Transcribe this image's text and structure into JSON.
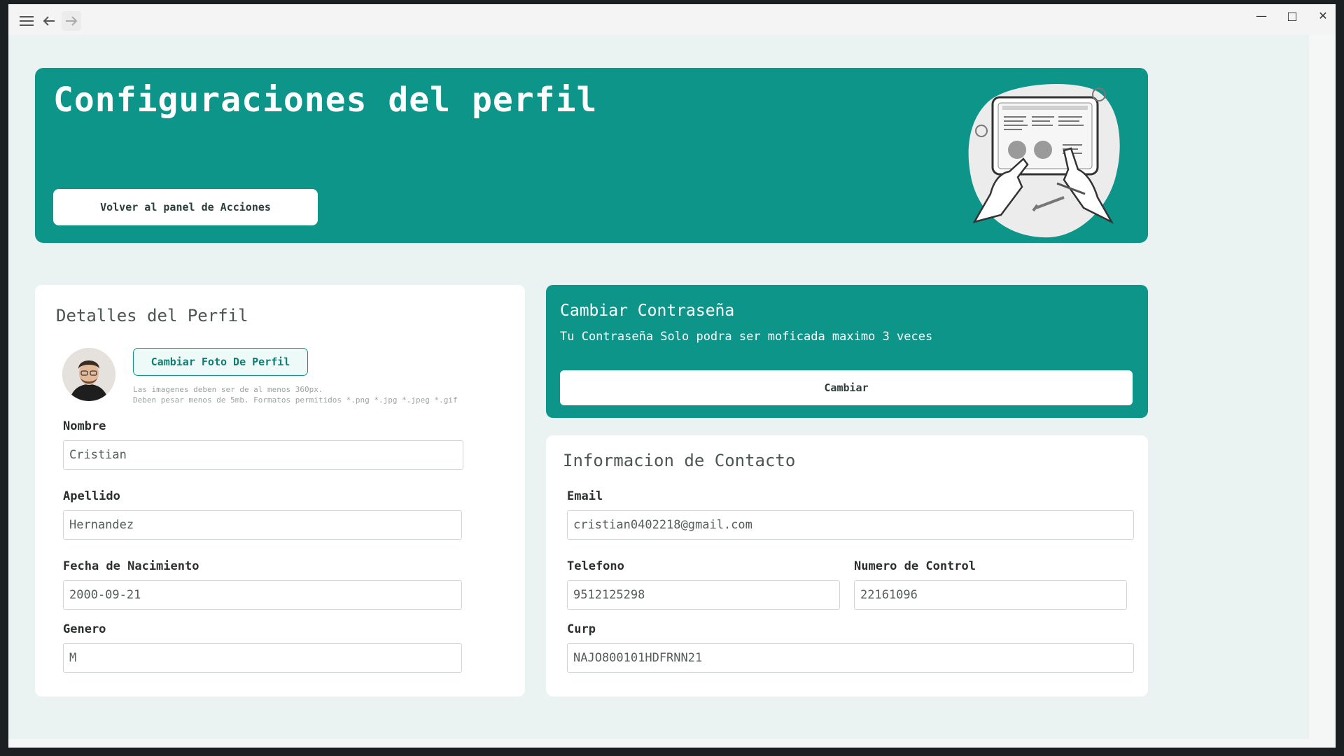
{
  "window": {
    "controls": {
      "minimize": "—",
      "maximize": "□",
      "close": "✕"
    },
    "nav": {
      "menu_icon": "menu-icon",
      "back_icon": "arrow-left-icon",
      "forward_icon": "arrow-right-icon"
    }
  },
  "colors": {
    "accent": "#0e958a",
    "background": "#eaf3f1"
  },
  "hero": {
    "title": "Configuraciones del perfil",
    "back_button": "Volver al panel de Acciones"
  },
  "profile": {
    "title": "Detalles del Perfil",
    "change_photo_button": "Cambiar Foto De Perfil",
    "photo_hint_line1": "Las imagenes deben ser de al menos 360px.",
    "photo_hint_line2": "Deben pesar menos de 5mb. Formatos permitidos *.png *.jpg *.jpeg *.gif",
    "fields": {
      "nombre": {
        "label": "Nombre",
        "value": "Cristian"
      },
      "apellido": {
        "label": "Apellido",
        "value": "Hernandez"
      },
      "fecha": {
        "label": "Fecha de Nacimiento",
        "value": "2000-09-21"
      },
      "genero": {
        "label": "Genero",
        "value": "M"
      }
    }
  },
  "password": {
    "title": "Cambiar Contraseña",
    "subtitle": "Tu Contraseña Solo podra ser moficada maximo 3 veces",
    "button": "Cambiar"
  },
  "contact": {
    "title": "Informacion de Contacto",
    "fields": {
      "email": {
        "label": "Email",
        "value": "cristian0402218@gmail.com"
      },
      "telefono": {
        "label": "Telefono",
        "value": "9512125298"
      },
      "control": {
        "label": "Numero de Control",
        "value": "22161096"
      },
      "curp": {
        "label": "Curp",
        "value": "NAJO800101HDFRNN21"
      }
    }
  }
}
